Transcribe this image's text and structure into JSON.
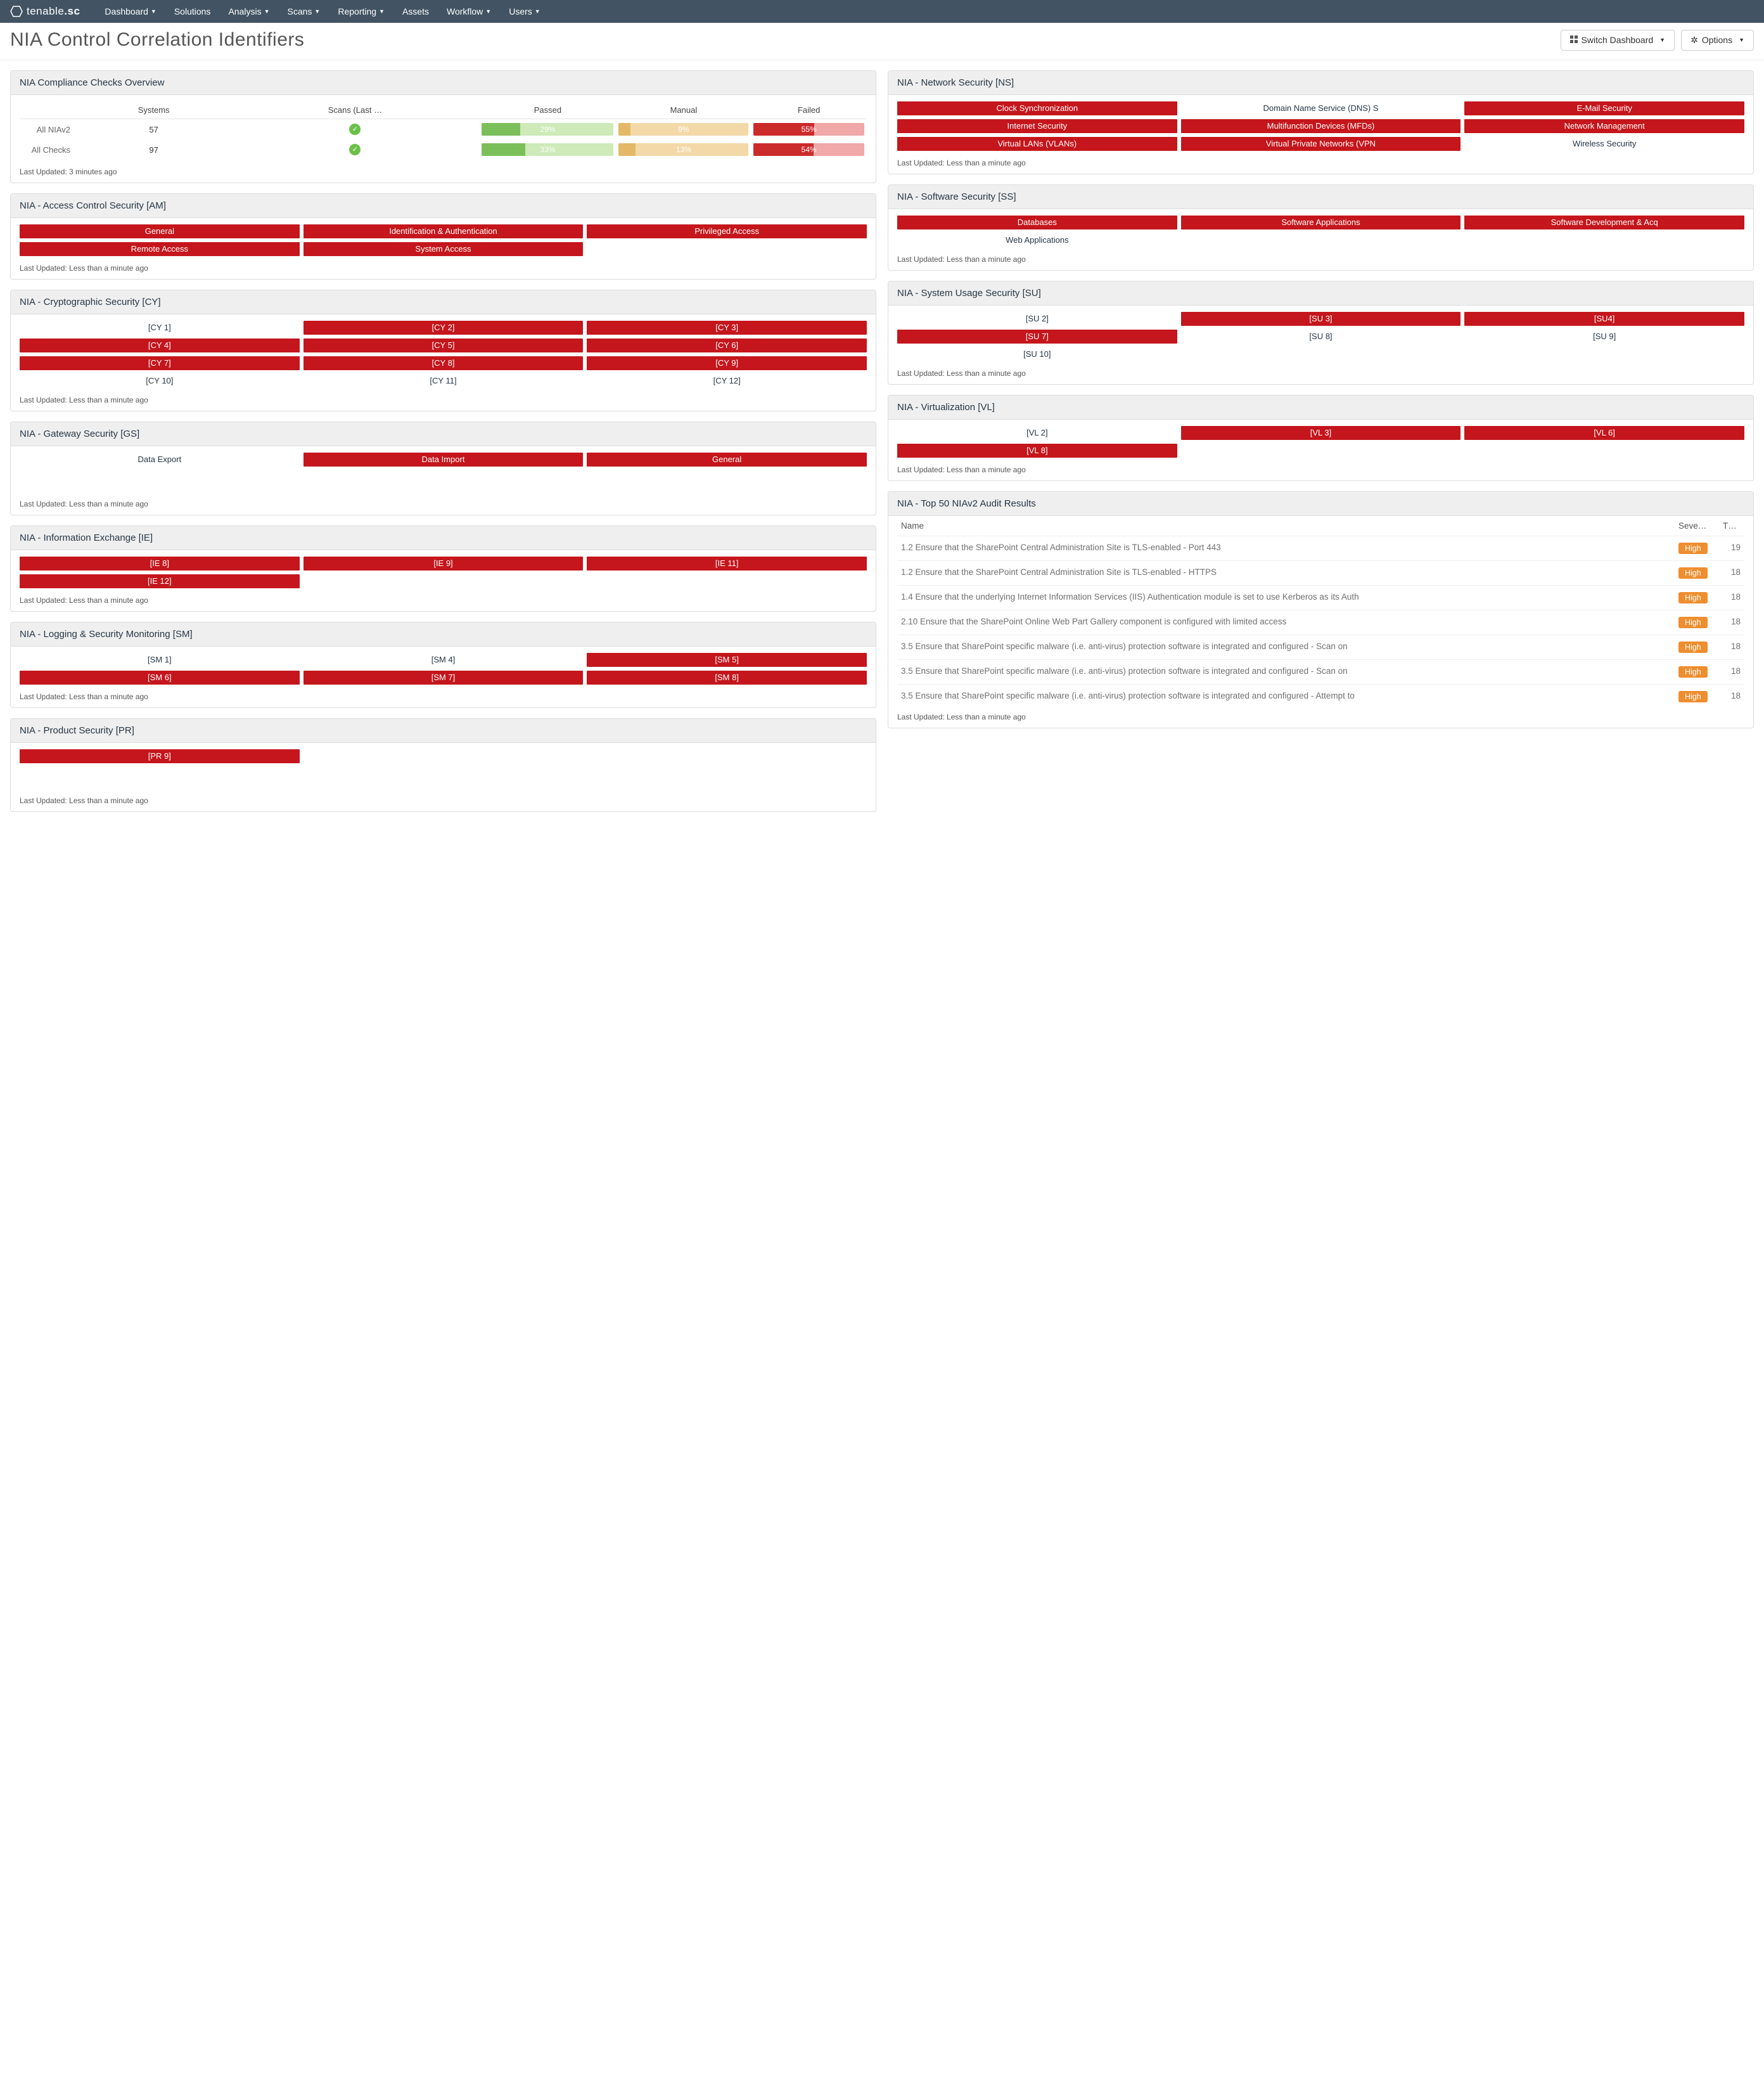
{
  "brand": {
    "name_a": "tenable",
    "name_b": ".sc"
  },
  "nav": [
    "Dashboard",
    "Solutions",
    "Analysis",
    "Scans",
    "Reporting",
    "Assets",
    "Workflow",
    "Users"
  ],
  "nav_has_caret": [
    true,
    false,
    true,
    true,
    true,
    false,
    true,
    true
  ],
  "page_title": "NIA Control Correlation Identifiers",
  "buttons": {
    "switch": "Switch Dashboard",
    "options": "Options"
  },
  "updated_minute": "Last Updated: Less than a minute ago",
  "updated_3min": "Last Updated: 3 minutes ago",
  "compliance": {
    "title": "NIA Compliance Checks Overview",
    "cols": [
      "",
      "Systems",
      "Scans (Last …",
      "Passed",
      "Manual",
      "Failed"
    ],
    "rows": [
      {
        "label": "All NIAv2",
        "systems": "57",
        "scans": "ok",
        "passed": 29,
        "manual": 9,
        "failed": 55
      },
      {
        "label": "All Checks",
        "systems": "97",
        "scans": "ok",
        "passed": 33,
        "manual": 13,
        "failed": 54
      }
    ]
  },
  "panels_left": [
    {
      "title": "NIA - Access Control Security [AM]",
      "pills": [
        {
          "t": "General",
          "r": 1
        },
        {
          "t": "Identification & Authentication",
          "r": 1
        },
        {
          "t": "Privileged Access",
          "r": 1
        },
        {
          "t": "Remote Access",
          "r": 1
        },
        {
          "t": "System Access",
          "r": 1
        }
      ]
    },
    {
      "title": "NIA - Cryptographic Security [CY]",
      "pills": [
        {
          "t": "[CY 1]",
          "r": 0
        },
        {
          "t": "[CY 2]",
          "r": 1
        },
        {
          "t": "[CY 3]",
          "r": 1
        },
        {
          "t": "[CY 4]",
          "r": 1
        },
        {
          "t": "[CY 5]",
          "r": 1
        },
        {
          "t": "[CY 6]",
          "r": 1
        },
        {
          "t": "[CY 7]",
          "r": 1
        },
        {
          "t": "[CY 8]",
          "r": 1
        },
        {
          "t": "[CY 9]",
          "r": 1
        },
        {
          "t": "[CY 10]",
          "r": 0
        },
        {
          "t": "[CY 11]",
          "r": 0
        },
        {
          "t": "[CY 12]",
          "r": 0
        }
      ]
    },
    {
      "title": "NIA - Gateway Security [GS]",
      "pills": [
        {
          "t": "Data Export",
          "r": 0
        },
        {
          "t": "Data Import",
          "r": 1
        },
        {
          "t": "General",
          "r": 1
        }
      ],
      "extra_space": true
    },
    {
      "title": "NIA - Information Exchange [IE]",
      "pills": [
        {
          "t": "[IE 8]",
          "r": 1
        },
        {
          "t": "[IE 9]",
          "r": 1
        },
        {
          "t": "[IE 11]",
          "r": 1
        },
        {
          "t": "[IE 12]",
          "r": 1
        }
      ]
    },
    {
      "title": "NIA - Logging & Security Monitoring [SM]",
      "pills": [
        {
          "t": "[SM 1]",
          "r": 0
        },
        {
          "t": "[SM 4]",
          "r": 0
        },
        {
          "t": "[SM 5]",
          "r": 1
        },
        {
          "t": "[SM 6]",
          "r": 1
        },
        {
          "t": "[SM 7]",
          "r": 1
        },
        {
          "t": "[SM 8]",
          "r": 1
        }
      ]
    },
    {
      "title": "NIA - Product Security [PR]",
      "pills": [
        {
          "t": "[PR 9]",
          "r": 1
        }
      ],
      "extra_space": true
    }
  ],
  "panels_right": [
    {
      "title": "NIA - Network Security [NS]",
      "pills": [
        {
          "t": "Clock Synchronization",
          "r": 1
        },
        {
          "t": "Domain Name Service (DNS) S",
          "r": 0
        },
        {
          "t": "E-Mail Security",
          "r": 1
        },
        {
          "t": "Internet Security",
          "r": 1
        },
        {
          "t": "Multifunction Devices (MFDs)",
          "r": 1
        },
        {
          "t": "Network Management",
          "r": 1
        },
        {
          "t": "Virtual LANs (VLANs)",
          "r": 1
        },
        {
          "t": "Virtual Private Networks (VPN",
          "r": 1
        },
        {
          "t": "Wireless Security",
          "r": 0
        }
      ]
    },
    {
      "title": "NIA - Software Security [SS]",
      "pills": [
        {
          "t": "Databases",
          "r": 1
        },
        {
          "t": "Software Applications",
          "r": 1
        },
        {
          "t": "Software Development & Acq",
          "r": 1
        },
        {
          "t": "Web Applications",
          "r": 0
        }
      ]
    },
    {
      "title": "NIA - System Usage Security [SU]",
      "pills": [
        {
          "t": "[SU 2]",
          "r": 0
        },
        {
          "t": "[SU 3]",
          "r": 1
        },
        {
          "t": "[SU4]",
          "r": 1
        },
        {
          "t": "[SU 7]",
          "r": 1
        },
        {
          "t": "[SU 8]",
          "r": 0
        },
        {
          "t": "[SU 9]",
          "r": 0
        },
        {
          "t": "[SU 10]",
          "r": 0
        }
      ]
    },
    {
      "title": "NIA - Virtualization [VL]",
      "pills": [
        {
          "t": "[VL 2]",
          "r": 0
        },
        {
          "t": "[VL 3]",
          "r": 1
        },
        {
          "t": "[VL 6]",
          "r": 1
        },
        {
          "t": "[VL 8]",
          "r": 1
        }
      ]
    }
  ],
  "audit": {
    "title": "NIA - Top 50 NIAv2 Audit Results",
    "cols": [
      "Name",
      "Seve…",
      "T…"
    ],
    "rows": [
      {
        "name": "1.2 Ensure that the SharePoint Central Administration Site is TLS-enabled - Port 443",
        "sev": "High",
        "tot": "19"
      },
      {
        "name": "1.2 Ensure that the SharePoint Central Administration Site is TLS-enabled - HTTPS",
        "sev": "High",
        "tot": "18"
      },
      {
        "name": "1.4 Ensure that the underlying Internet Information Services (IIS) Authentication module is set to use Kerberos as its Auth",
        "sev": "High",
        "tot": "18"
      },
      {
        "name": "2.10 Ensure that the SharePoint Online Web Part Gallery component is configured with limited access",
        "sev": "High",
        "tot": "18"
      },
      {
        "name": "3.5 Ensure that SharePoint specific malware (i.e. anti-virus) protection software is integrated and configured - Scan on",
        "sev": "High",
        "tot": "18"
      },
      {
        "name": "3.5 Ensure that SharePoint specific malware (i.e. anti-virus) protection software is integrated and configured - Scan on",
        "sev": "High",
        "tot": "18"
      },
      {
        "name": "3.5 Ensure that SharePoint specific malware (i.e. anti-virus) protection software is integrated and configured - Attempt to",
        "sev": "High",
        "tot": "18"
      }
    ]
  }
}
